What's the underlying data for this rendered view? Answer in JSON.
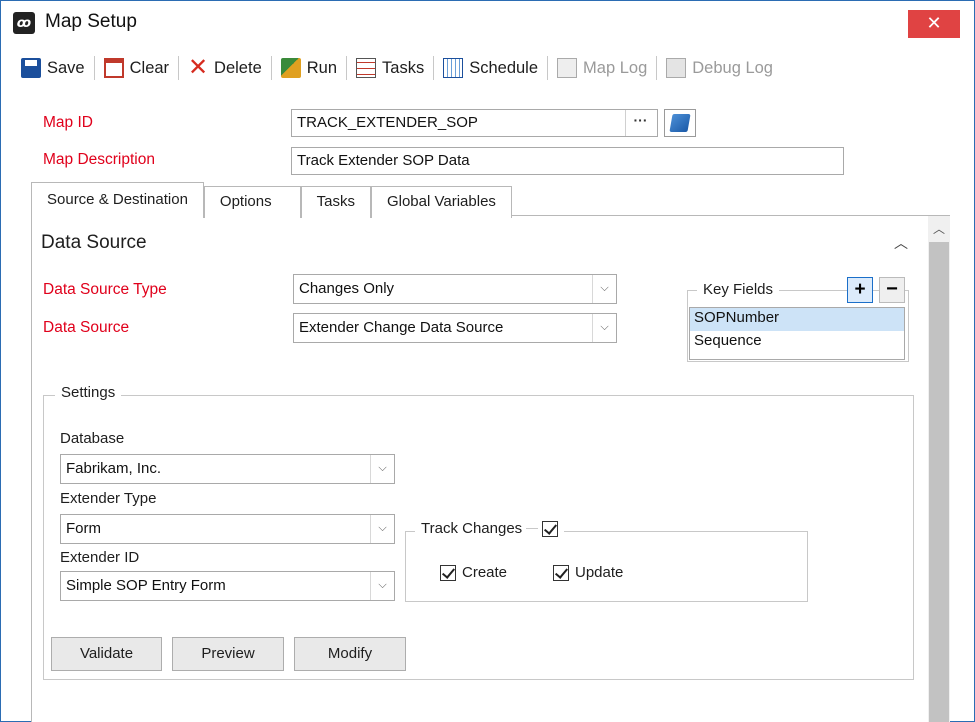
{
  "window": {
    "title": "Map Setup",
    "close_glyph": "✕",
    "app_icon_glyph": "ꝏ"
  },
  "toolbar": {
    "items": [
      {
        "label": "Save",
        "icon": "save-icon",
        "enabled": true
      },
      {
        "label": "Clear",
        "icon": "clear-icon",
        "enabled": true
      },
      {
        "label": "Delete",
        "icon": "delete-icon",
        "enabled": true
      },
      {
        "label": "Run",
        "icon": "run-icon",
        "enabled": true
      },
      {
        "label": "Tasks",
        "icon": "tasks-icon",
        "enabled": true
      },
      {
        "label": "Schedule",
        "icon": "schedule-icon",
        "enabled": true
      },
      {
        "label": "Map Log",
        "icon": "map-log-icon",
        "enabled": false
      },
      {
        "label": "Debug Log",
        "icon": "debug-log-icon",
        "enabled": false
      }
    ]
  },
  "header": {
    "map_id_label": "Map ID",
    "map_id_value": "TRACK_EXTENDER_SOP",
    "ellipsis_glyph": "···",
    "map_description_label": "Map Description",
    "map_description_value": "Track Extender SOP Data"
  },
  "tabs": [
    {
      "label": "Source & Destination",
      "active": true
    },
    {
      "label": "Options",
      "active": false
    },
    {
      "label": "Tasks",
      "active": false
    },
    {
      "label": "Global Variables",
      "active": false
    }
  ],
  "data_source": {
    "section_title": "Data Source",
    "collapse_glyph": "︿",
    "type_label": "Data Source Type",
    "type_value": "Changes Only",
    "source_label": "Data Source",
    "source_value": "Extender Change Data Source",
    "dropdown_glyph": "⌵"
  },
  "key_fields": {
    "legend": "Key Fields",
    "add_glyph": "+",
    "remove_glyph": "−",
    "items": [
      {
        "label": "SOPNumber",
        "selected": true
      },
      {
        "label": "Sequence",
        "selected": false
      }
    ]
  },
  "settings": {
    "legend": "Settings",
    "database_label": "Database",
    "database_value": "Fabrikam, Inc.",
    "extender_type_label": "Extender Type",
    "extender_type_value": "Form",
    "extender_id_label": "Extender ID",
    "extender_id_value": "Simple SOP Entry Form",
    "track_changes": {
      "legend": "Track Changes",
      "checked": true,
      "create_label": "Create",
      "create_checked": true,
      "update_label": "Update",
      "update_checked": true
    },
    "buttons": {
      "validate": "Validate",
      "preview": "Preview",
      "modify": "Modify"
    }
  },
  "scrollbar": {
    "up_glyph": "︿"
  }
}
